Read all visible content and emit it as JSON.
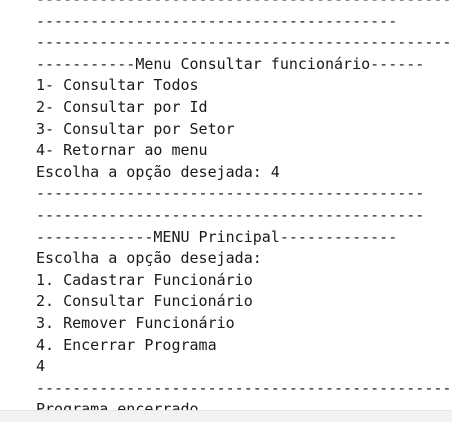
{
  "console": {
    "lines": [
      "-----------------------------------------------",
      "----------------------------------------",
      "--------------------------------------------------",
      "-----------Menu Consultar funcionário------",
      "1- Consultar Todos",
      "2- Consultar por Id",
      "3- Consultar por Setor",
      "4- Retornar ao menu",
      "Escolha a opção desejada: 4",
      "-------------------------------------------",
      "-------------------------------------------",
      "-------------MENU Principal-------------",
      "Escolha a opção desejada:",
      "1. Cadastrar Funcionário",
      "2. Consultar Funcionário",
      "3. Remover Funcionário",
      "4. Encerrar Programa",
      "4",
      "--------------------------------------------------",
      "Programa encerrado."
    ]
  }
}
